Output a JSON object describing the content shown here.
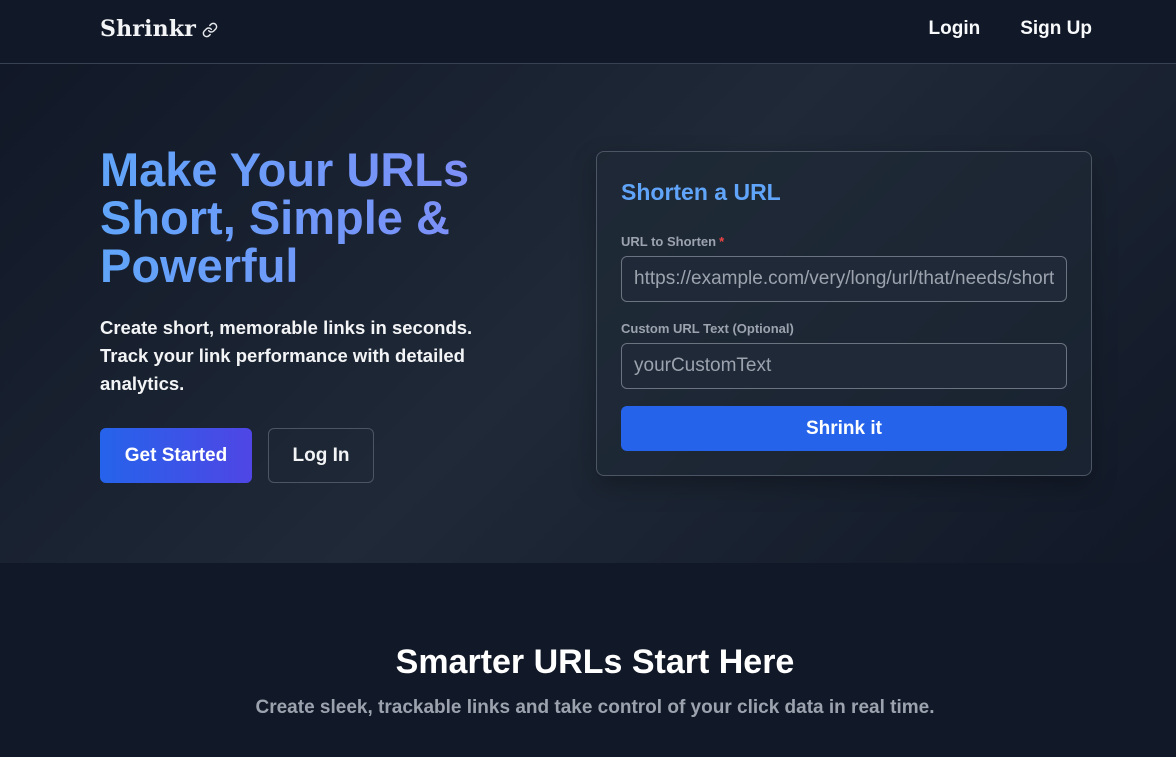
{
  "nav": {
    "brand": "Shrinkr",
    "brand_icon": "link-icon",
    "login_label": "Login",
    "signup_label": "Sign Up"
  },
  "hero": {
    "title_lines": [
      "Make Your URLs",
      "Short, Simple &",
      "Powerful"
    ],
    "description_lines": [
      "Create short, memorable links in seconds.",
      "Track your link performance with detailed",
      "analytics."
    ],
    "get_started_label": "Get Started",
    "login_label": "Log In"
  },
  "form": {
    "title": "Shorten a URL",
    "url_label": "URL to Shorten",
    "required_mark": "*",
    "url_placeholder": "https://example.com/very/long/url/that/needs/shortening",
    "custom_label": "Custom URL Text (Optional)",
    "custom_placeholder": "yourCustomText",
    "submit_label": "Shrink it"
  },
  "section": {
    "title": "Smarter URLs Start Here",
    "subtitle": "Create sleek, trackable links and take control of your click data in real time."
  },
  "colors": {
    "background": "#111827",
    "accent_blue": "#2563eb",
    "accent_indigo": "#4f46e5",
    "title_blue": "#60a5fa",
    "required_red": "#ef4444"
  }
}
